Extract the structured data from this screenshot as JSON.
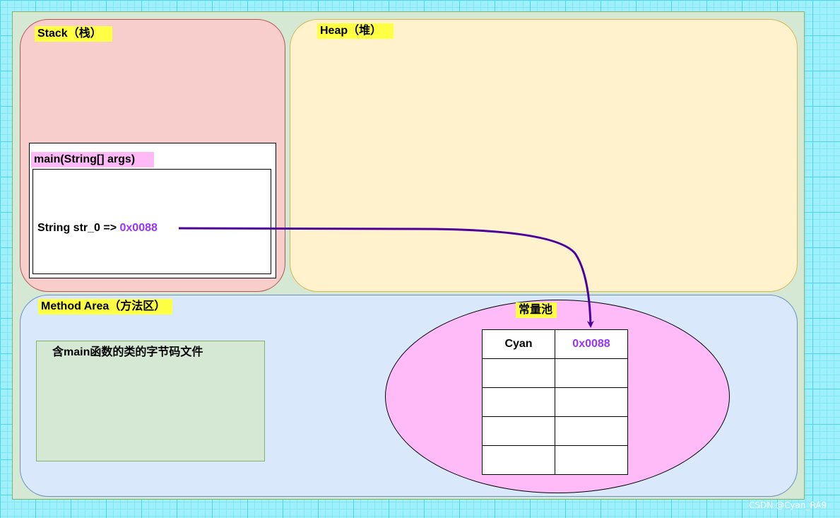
{
  "regions": {
    "stack_label": "Stack（栈）",
    "heap_label": "Heap（堆）",
    "method_area_label": "Method Area（方法区）"
  },
  "stack_frame": {
    "label": "main(String[] args)",
    "variable_decl": "String str_0 => ",
    "variable_address": "0x0088"
  },
  "method_area": {
    "bytecode_label": "含main函数的类的字节码文件",
    "constant_pool": {
      "label": "常量池",
      "rows": [
        [
          "Cyan",
          "0x0088"
        ],
        [
          "",
          ""
        ],
        [
          "",
          ""
        ],
        [
          "",
          ""
        ],
        [
          "",
          ""
        ]
      ]
    }
  },
  "watermark": "CSDN @Cyan_RA9",
  "colors": {
    "address_text": "#9933ff",
    "arrow": "#4c0099",
    "label_highlight_yellow": "#ffff44",
    "label_highlight_pink": "#ffb9f7"
  }
}
